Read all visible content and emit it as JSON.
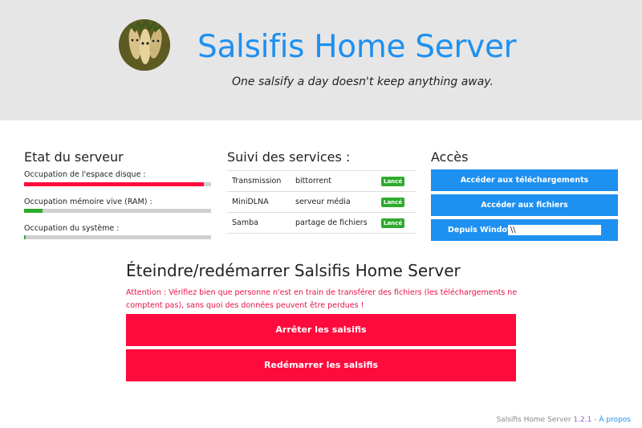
{
  "header": {
    "title": "Salsifis Home Server",
    "tagline": "One salsify a day doesn't keep anything away."
  },
  "server_status": {
    "title": "Etat du serveur",
    "metrics": [
      {
        "label": "Occupation de l'espace disque :",
        "fraction": 0.96,
        "color": "#ff0a3c"
      },
      {
        "label": "Occupation mémoire vive (RAM) :",
        "fraction": 0.1,
        "color": "#2eab2e"
      },
      {
        "label": "Occupation du système :",
        "fraction": 0.01,
        "color": "#2eab2e"
      }
    ]
  },
  "services": {
    "title": "Suivi des services :",
    "rows": [
      {
        "name": "Transmission",
        "description": "bittorrent",
        "status": "Lancé"
      },
      {
        "name": "MiniDLNA",
        "description": "serveur média",
        "status": "Lancé"
      },
      {
        "name": "Samba",
        "description": "partage de fichiers",
        "status": "Lancé"
      }
    ]
  },
  "access": {
    "title": "Accès",
    "downloads_label": "Accéder aux téléchargements",
    "files_label": "Accéder aux fichiers",
    "windows_label": "Depuis Windows :",
    "windows_value": "\\\\"
  },
  "shutdown": {
    "title": "Éteindre/redémarrer Salsifis Home Server",
    "warning": "Attention : Vérifiez bien que personne n'est en train de transférer des fichiers (les téléchargements ne comptent pas), sans quoi des données peuvent être perdues !",
    "stop_label": "Arrêter les salsifis",
    "restart_label": "Redémarrer les salsifis"
  },
  "footer": {
    "app_name": "Salsifis Home Server",
    "version": "1.2.1",
    "separator": "-",
    "about_label": "À propos"
  },
  "colors": {
    "accent": "#1e90f0",
    "danger": "#ff0a3c",
    "ok": "#2eab2e",
    "header_bg": "#e6e6e6"
  }
}
